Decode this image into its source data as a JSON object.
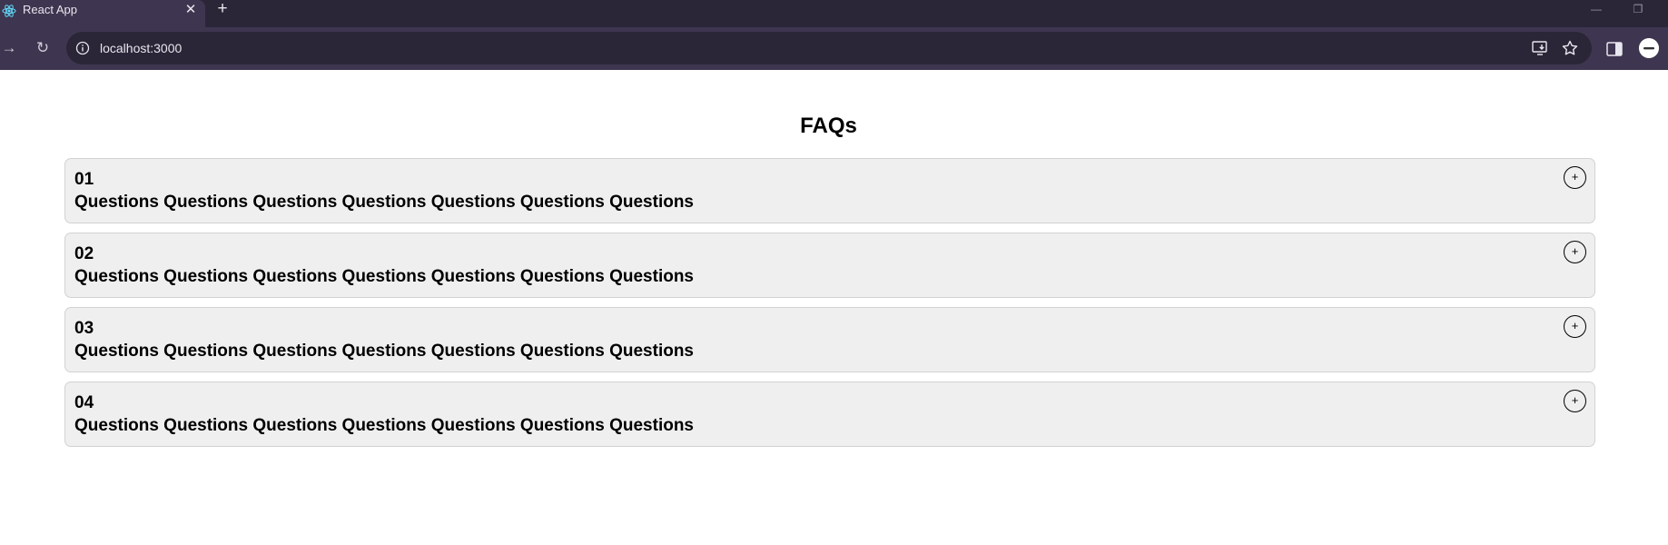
{
  "browser": {
    "tab": {
      "title": "React App",
      "favicon": "react-logo-icon",
      "close_glyph": "✕"
    },
    "new_tab_glyph": "+",
    "window_controls": {
      "minimize_glyph": "—",
      "maximize_glyph": "❐"
    },
    "toolbar": {
      "back_glyph": "←",
      "forward_glyph": "→",
      "reload_glyph": "↻",
      "url": "localhost:3000"
    },
    "colors": {
      "tabstrip": "#2b2538",
      "toolbar": "#3e3650",
      "omnibox": "#2b2538"
    }
  },
  "page": {
    "title": "FAQs",
    "faqs": [
      {
        "number": "01",
        "question": "Questions Questions Questions Questions Questions Questions Questions",
        "toggle": "+"
      },
      {
        "number": "02",
        "question": "Questions Questions Questions Questions Questions Questions Questions",
        "toggle": "+"
      },
      {
        "number": "03",
        "question": "Questions Questions Questions Questions Questions Questions Questions",
        "toggle": "+"
      },
      {
        "number": "04",
        "question": "Questions Questions Questions Questions Questions Questions Questions",
        "toggle": "+"
      }
    ],
    "colors": {
      "card_background": "#efefef",
      "card_border": "#d2d2d2",
      "text": "#000000"
    }
  }
}
